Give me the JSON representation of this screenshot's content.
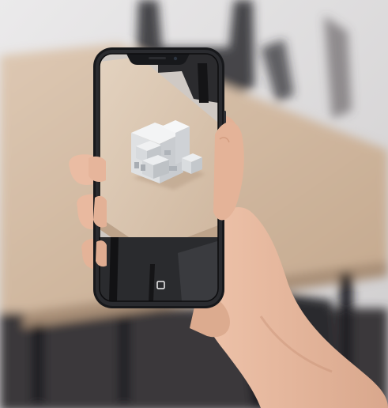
{
  "scene": {
    "colors": {
      "wall": "#d9d7d8",
      "table_top": "#cdb69f",
      "table_edge": "#b49a81",
      "floor": "#2d2d30",
      "chair": "#1c1c1f",
      "skin": "#e6b79e",
      "skin_shadow": "#cf9b80",
      "phone_body": "#17181b",
      "screen_table": "#d8c4ad",
      "model_light": "#f1f2f3",
      "model_mid": "#dfe1e3",
      "model_dark": "#c8cbcf"
    },
    "phone": {
      "home_icon": "square-home-icon"
    }
  }
}
